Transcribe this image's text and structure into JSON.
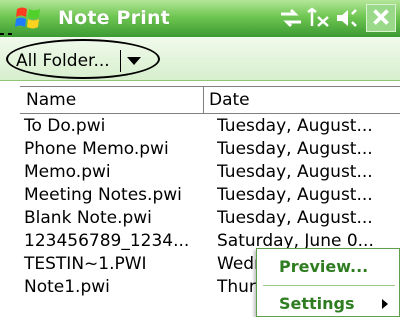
{
  "titlebar": {
    "app_title": "Note Print",
    "start_icon": "windows-flag-icon",
    "status_icons": [
      "connectivity-icon",
      "signal-icon",
      "volume-icon"
    ],
    "close_icon": "close-icon",
    "colors": {
      "bar": "#4fae3d",
      "title_text": "#ffffff"
    }
  },
  "toolbar": {
    "folder_label": "All Folder...",
    "dropdown_icon": "chevron-down-icon"
  },
  "list": {
    "columns": [
      {
        "label": "Name"
      },
      {
        "label": "Date"
      }
    ],
    "rows": [
      {
        "name": "To Do.pwi",
        "date": "Tuesday, August..."
      },
      {
        "name": "Phone Memo.pwi",
        "date": "Tuesday, August..."
      },
      {
        "name": "Memo.pwi",
        "date": "Tuesday, August..."
      },
      {
        "name": "Meeting Notes.pwi",
        "date": "Tuesday, August..."
      },
      {
        "name": "Blank Note.pwi",
        "date": "Tuesday, August..."
      },
      {
        "name": "123456789_1234...",
        "date": "Saturday, June 0..."
      },
      {
        "name": "TESTIN~1.PWI",
        "date": "Wednesday, ..."
      },
      {
        "name": "Note1.pwi",
        "date": "Thursday, ..."
      }
    ]
  },
  "popup_menu": {
    "items": [
      {
        "label": "Preview..."
      },
      {
        "label": "Settings",
        "icon": "submenu-arrow-icon"
      }
    ],
    "color": "#2f7d21"
  }
}
